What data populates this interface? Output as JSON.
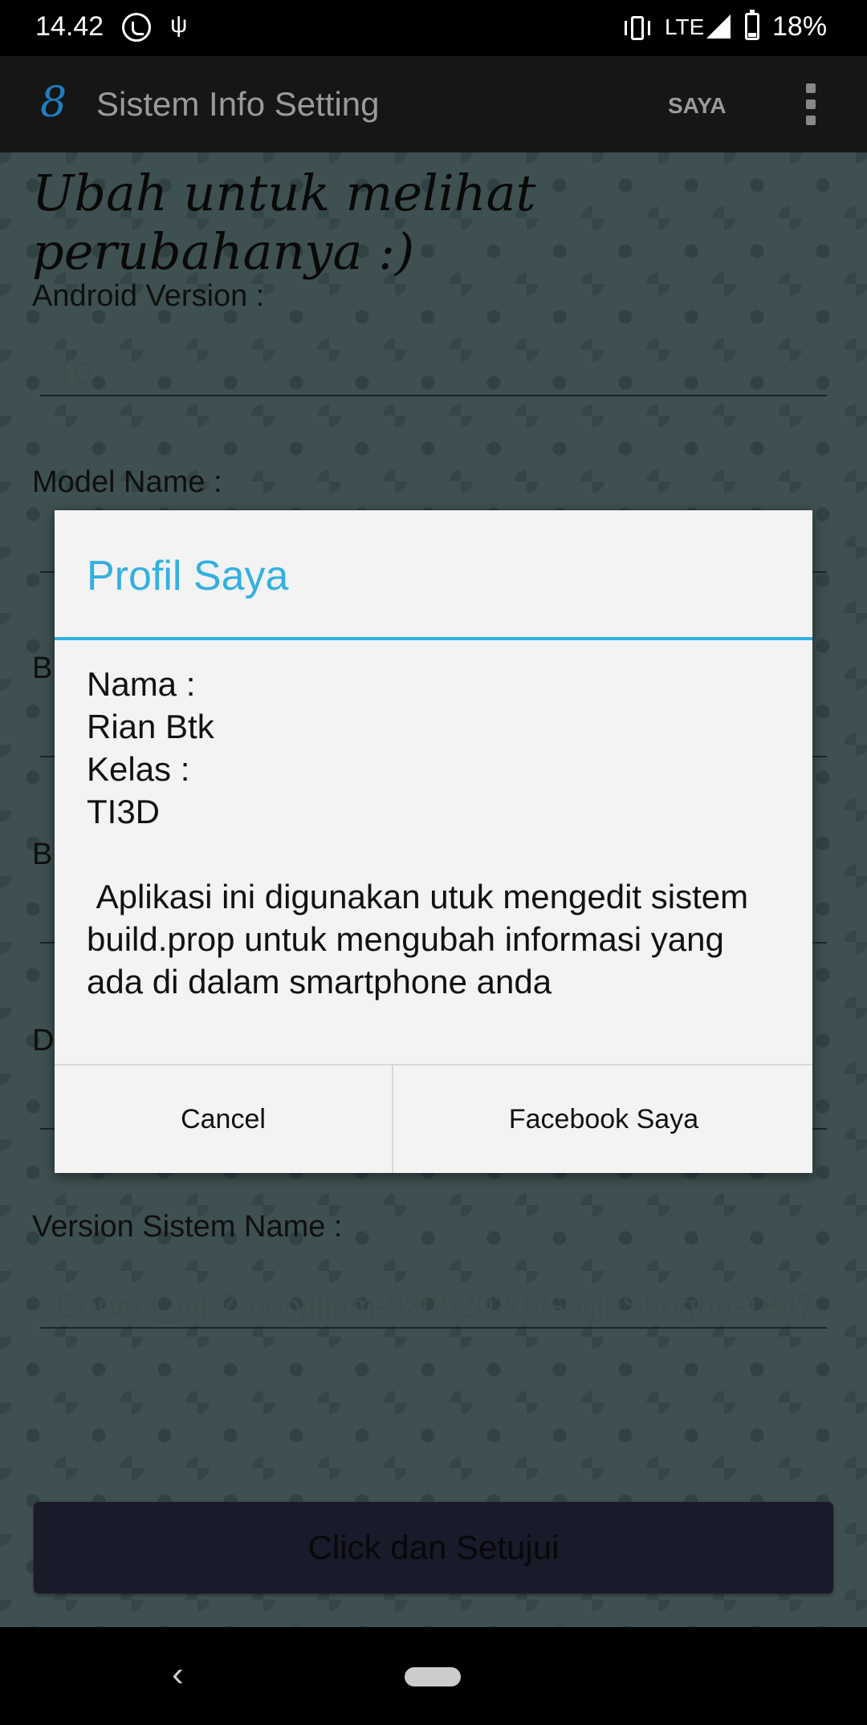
{
  "status_bar": {
    "time": "14.42",
    "network": "LTE",
    "battery": "18%",
    "battery_level": 0.18,
    "icons": [
      "whatsapp-icon",
      "usb-icon",
      "vibrate-icon",
      "signal-icon",
      "battery-icon"
    ]
  },
  "app_bar": {
    "logo_glyph": "8",
    "title": "Sistem Info Setting",
    "action_label": "SAYA",
    "overflow_icon": "more-vert-icon"
  },
  "form": {
    "heading": "Ubah untuk melihat perubahanya :)",
    "android_version_label": "Android Version :",
    "android_version_value": "10",
    "model_name_label": "Model Name :",
    "hidden_label_1": "B",
    "hidden_label_2": "B",
    "hidden_label_3": "D",
    "version_sistem_label": "Version Sistem Name :",
    "version_sistem_value": "Corvus_v4.7-beryllium-02052020-GaijinShogun-1847",
    "submit_label": "Click dan Setujui"
  },
  "dialog": {
    "title": "Profil Saya",
    "body": "Nama :\nRian Btk\nKelas :\nTI3D\n\n Aplikasi ini digunakan utuk mengedit sistem build.prop untuk mengubah informasi yang ada di dalam smartphone anda",
    "cancel_label": "Cancel",
    "facebook_label": "Facebook Saya",
    "accent_color": "#33b0e0"
  },
  "nav_bar": {
    "back_glyph": "‹",
    "icons": [
      "back-icon",
      "home-pill-icon"
    ]
  }
}
